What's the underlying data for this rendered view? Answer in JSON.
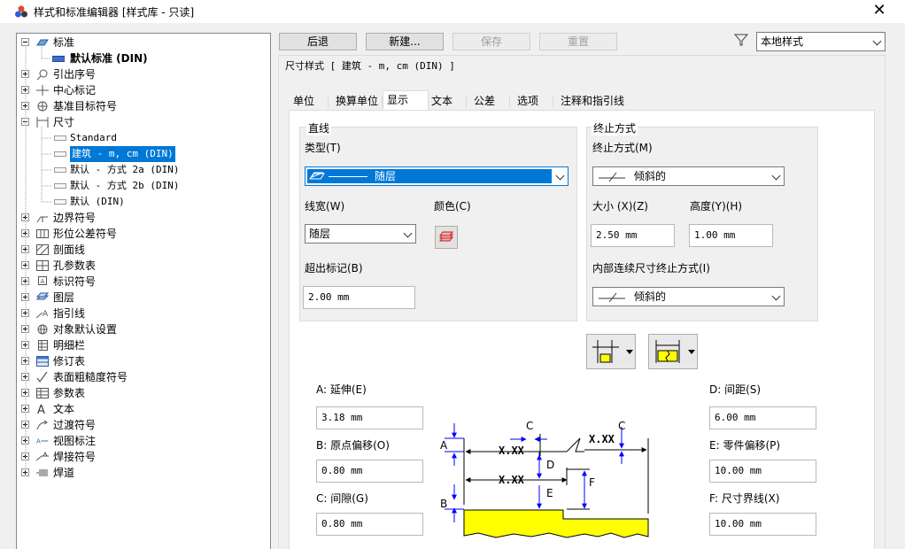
{
  "window": {
    "title": "样式和标准编辑器 [样式库 - 只读]",
    "close": "✕"
  },
  "tree": {
    "items": [
      {
        "label": "标准",
        "icon": "standard-icon",
        "expanded": true
      },
      {
        "label": "默认标准 (DIN)",
        "icon": "default-standard-icon"
      },
      {
        "label": "引出序号",
        "icon": "balloon-icon"
      },
      {
        "label": "中心标记",
        "icon": "center-mark-icon"
      },
      {
        "label": "基准目标符号",
        "icon": "datum-target-icon"
      },
      {
        "label": "尺寸",
        "icon": "dimension-icon",
        "expanded": true
      },
      {
        "label": "Standard"
      },
      {
        "label": "建筑 - m, cm (DIN)"
      },
      {
        "label": "默认 - 方式 2a (DIN)"
      },
      {
        "label": "默认 - 方式 2b (DIN)"
      },
      {
        "label": "默认 (DIN)"
      },
      {
        "label": "边界符号",
        "icon": "boundary-icon"
      },
      {
        "label": "形位公差符号",
        "icon": "gdt-icon"
      },
      {
        "label": "剖面线",
        "icon": "hatch-icon"
      },
      {
        "label": "孔参数表",
        "icon": "hole-table-icon"
      },
      {
        "label": "标识符号",
        "icon": "id-symbol-icon"
      },
      {
        "label": "图层",
        "icon": "layers-icon"
      },
      {
        "label": "指引线",
        "icon": "leader-icon"
      },
      {
        "label": "对象默认设置",
        "icon": "object-defaults-icon"
      },
      {
        "label": "明细栏",
        "icon": "parts-list-icon"
      },
      {
        "label": "修订表",
        "icon": "revision-table-icon"
      },
      {
        "label": "表面粗糙度符号",
        "icon": "surface-texture-icon"
      },
      {
        "label": "参数表",
        "icon": "table-icon"
      },
      {
        "label": "文本",
        "icon": "text-icon"
      },
      {
        "label": "过渡符号",
        "icon": "transition-icon"
      },
      {
        "label": "视图标注",
        "icon": "view-annotation-icon"
      },
      {
        "label": "焊接符号",
        "icon": "weld-symbol-icon"
      },
      {
        "label": "焊道",
        "icon": "weld-bead-icon"
      }
    ]
  },
  "toolbar": {
    "back": "后退",
    "new": "新建...",
    "save": "保存",
    "reset": "重置",
    "filter_value": "本地样式"
  },
  "panel": {
    "heading": "尺寸样式 [ 建筑 - m, cm (DIN) ]",
    "tabs": [
      "单位",
      "换算单位",
      "显示",
      "文本",
      "公差",
      "选项",
      "注释和指引线"
    ],
    "line": {
      "group_title": "直线",
      "type_label": "类型(T)",
      "type_value": "随层",
      "width_label": "线宽(W)",
      "width_value": "随层",
      "color_label": "颜色(C)",
      "ext_label": "超出标记(B)",
      "ext_value": "2.00 mm"
    },
    "term": {
      "group_title": "终止方式",
      "term_label": "终止方式(M)",
      "term_value": "倾斜的",
      "size_label": "大小 (X)(Z)",
      "size_value": "2.50 mm",
      "height_label": "高度(Y)(H)",
      "height_value": "1.00 mm",
      "inner_label": "内部连续尺寸终止方式(I)",
      "inner_value": "倾斜的"
    },
    "dims": {
      "a_label": "A: 延伸(E)",
      "a_value": "3.18 mm",
      "b_label": "B: 原点偏移(O)",
      "b_value": "0.80 mm",
      "c_label": "C: 间隙(G)",
      "c_value": "0.80 mm",
      "d_label": "D: 间距(S)",
      "d_value": "6.00 mm",
      "e_label": "E: 零件偏移(P)",
      "e_value": "10.00 mm",
      "f_label": "F: 尺寸界线(X)",
      "f_value": "10.00 mm"
    },
    "diagram": {
      "xx": "X.XX",
      "A": "A",
      "B": "B",
      "C": "C",
      "D": "D",
      "E": "E",
      "F": "F"
    }
  },
  "colors": {
    "accent": "#0078d7",
    "dim_blue": "#0000ff",
    "part_yellow": "#ffff00"
  }
}
